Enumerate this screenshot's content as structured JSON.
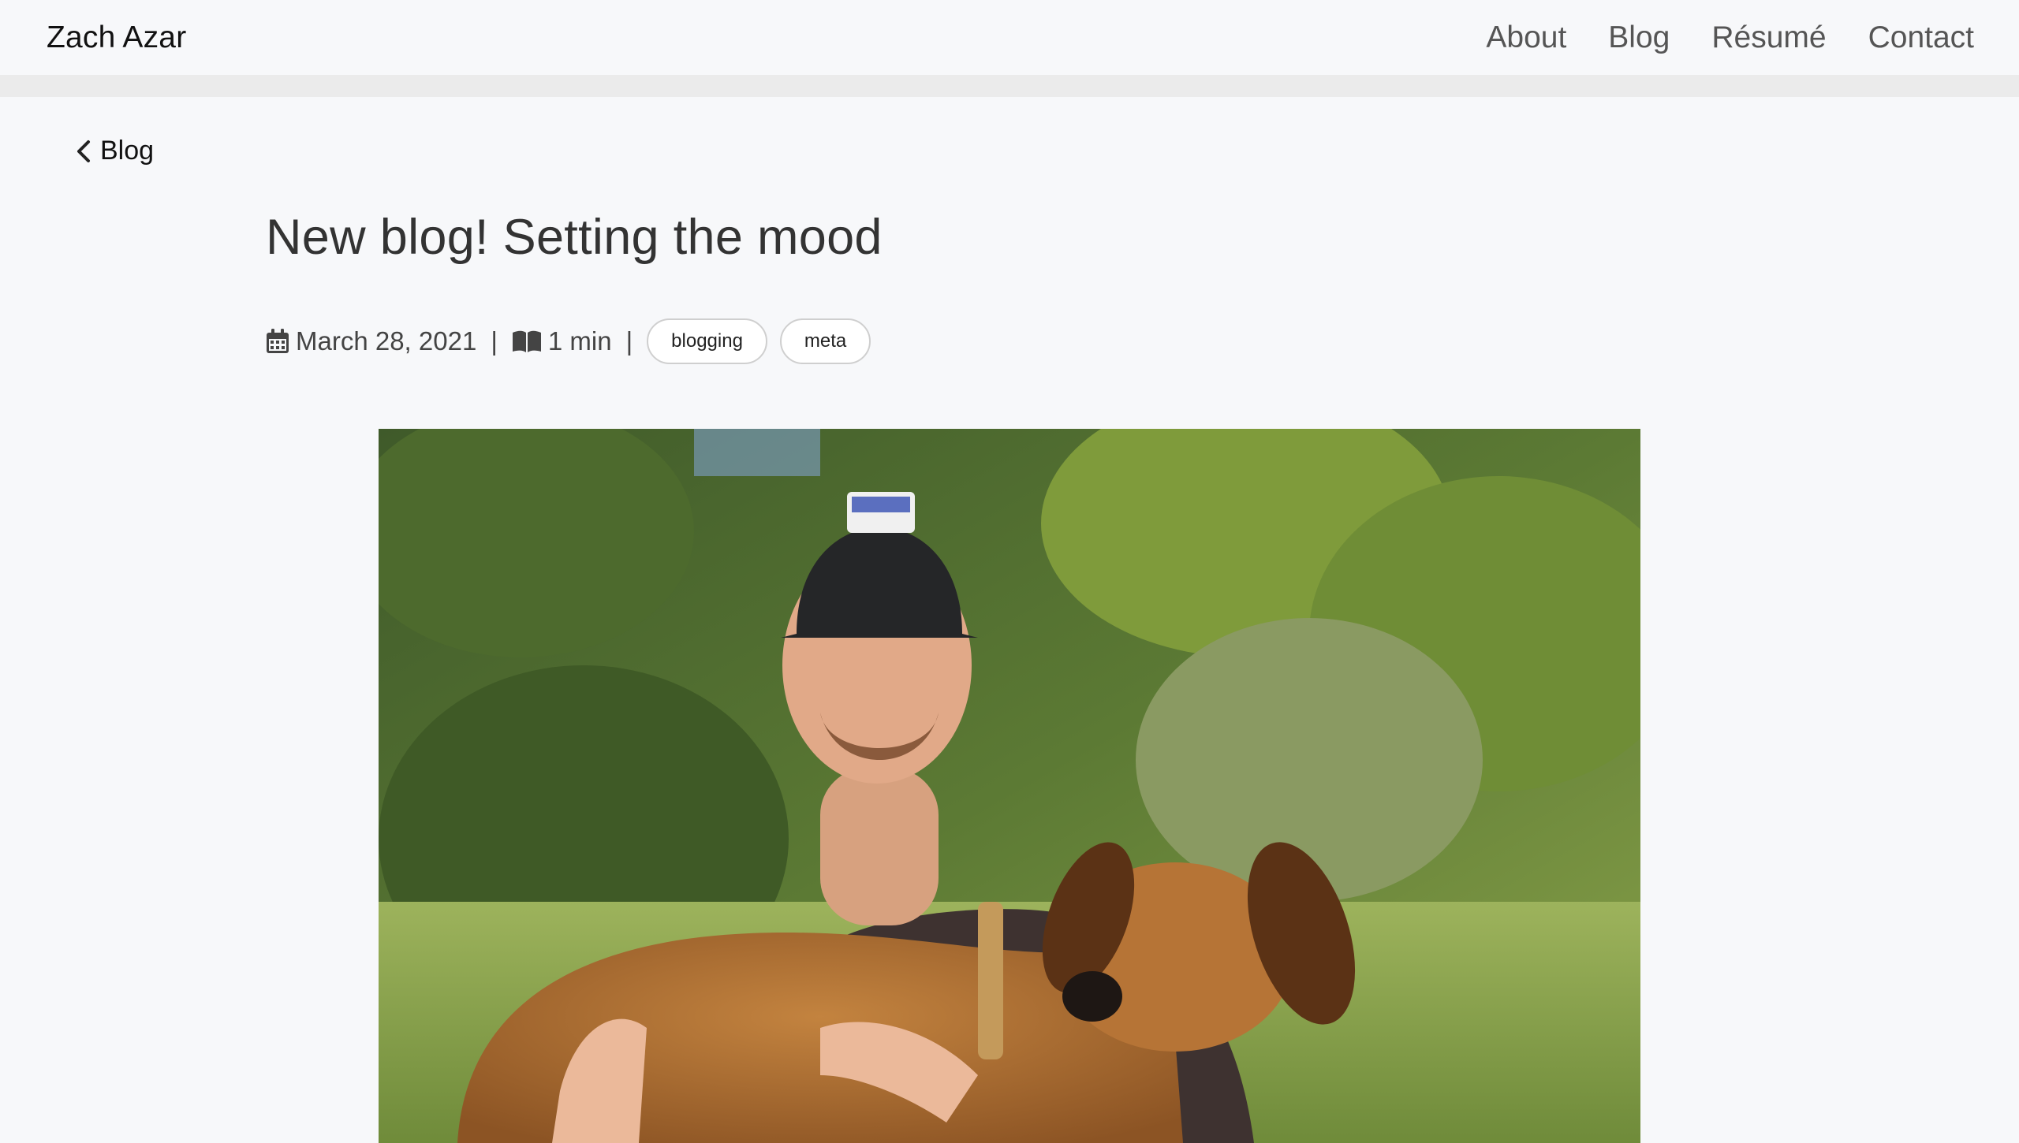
{
  "header": {
    "site_name": "Zach Azar",
    "nav": [
      {
        "label": "About"
      },
      {
        "label": "Blog"
      },
      {
        "label": "Résumé"
      },
      {
        "label": "Contact"
      }
    ]
  },
  "back_link": {
    "label": "Blog",
    "icon": "chevron-left-icon"
  },
  "post": {
    "title": "New blog! Setting the mood",
    "date": "March 28, 2021",
    "date_icon": "calendar-icon",
    "read_time": "1 min",
    "read_time_icon": "book-open-icon",
    "separator": "|",
    "tags": [
      "blogging",
      "meta"
    ]
  },
  "image": {
    "subject": "photo"
  },
  "colors": {
    "background": "#f7f8fa",
    "band": "#ebebeb",
    "text": "#333333"
  }
}
